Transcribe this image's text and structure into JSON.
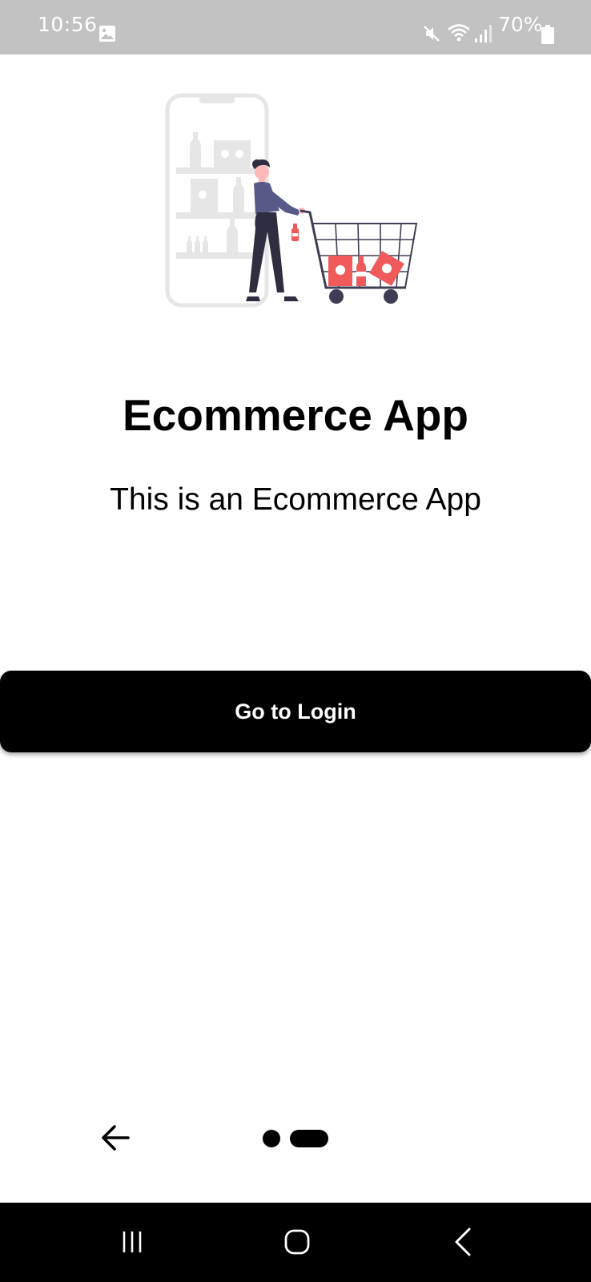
{
  "status_bar": {
    "time": "10:56",
    "battery_percent": "70%",
    "icons": [
      "gallery-icon",
      "mute-icon",
      "wifi-icon",
      "signal-icon",
      "battery-icon"
    ]
  },
  "hero": {
    "illustration": "woman-shopping-cart-illustration",
    "colors": {
      "phone": "#e6e6e6",
      "accent": "#f05a5a",
      "shirt": "#575a89",
      "dark": "#2f2e41",
      "skin": "#ffb8b8"
    }
  },
  "main": {
    "title": "Ecommerce App",
    "subtitle": "This is an Ecommerce App",
    "login_button_label": "Go to Login"
  },
  "pager": {
    "back_icon": "arrow-left-icon",
    "page_count": 2,
    "active_page": 2
  },
  "nav_bar": {
    "icons": [
      "recents-icon",
      "home-icon",
      "back-icon"
    ]
  }
}
